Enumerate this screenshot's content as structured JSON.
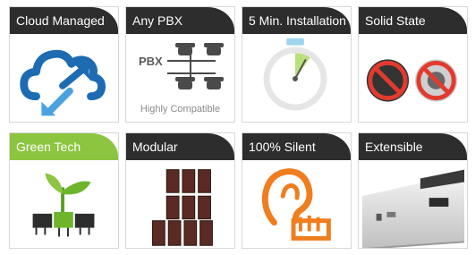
{
  "tiles": [
    {
      "title": "Cloud Managed"
    },
    {
      "title": "Any PBX",
      "pbx_label": "PBX",
      "caption": "Highly Compatible"
    },
    {
      "title": "5 Min. Installation"
    },
    {
      "title": "Solid State"
    },
    {
      "title": "Green Tech"
    },
    {
      "title": "Modular"
    },
    {
      "title": "100% Silent"
    },
    {
      "title": "Extensible"
    }
  ],
  "colors": {
    "header_dark": "#2d2d2d",
    "header_green": "#8cc53f",
    "cloud_blue": "#1d6bb3",
    "silent_orange": "#f07d1e",
    "prohibit_red": "#e23b2e"
  },
  "icons": [
    "cloud-sync-icon",
    "pbx-phones-icon",
    "stopwatch-icon",
    "no-fan-no-disk-icon",
    "seedling-circuit-icon",
    "modules-icon",
    "silent-ear-icon",
    "extension-chassis-icon"
  ]
}
